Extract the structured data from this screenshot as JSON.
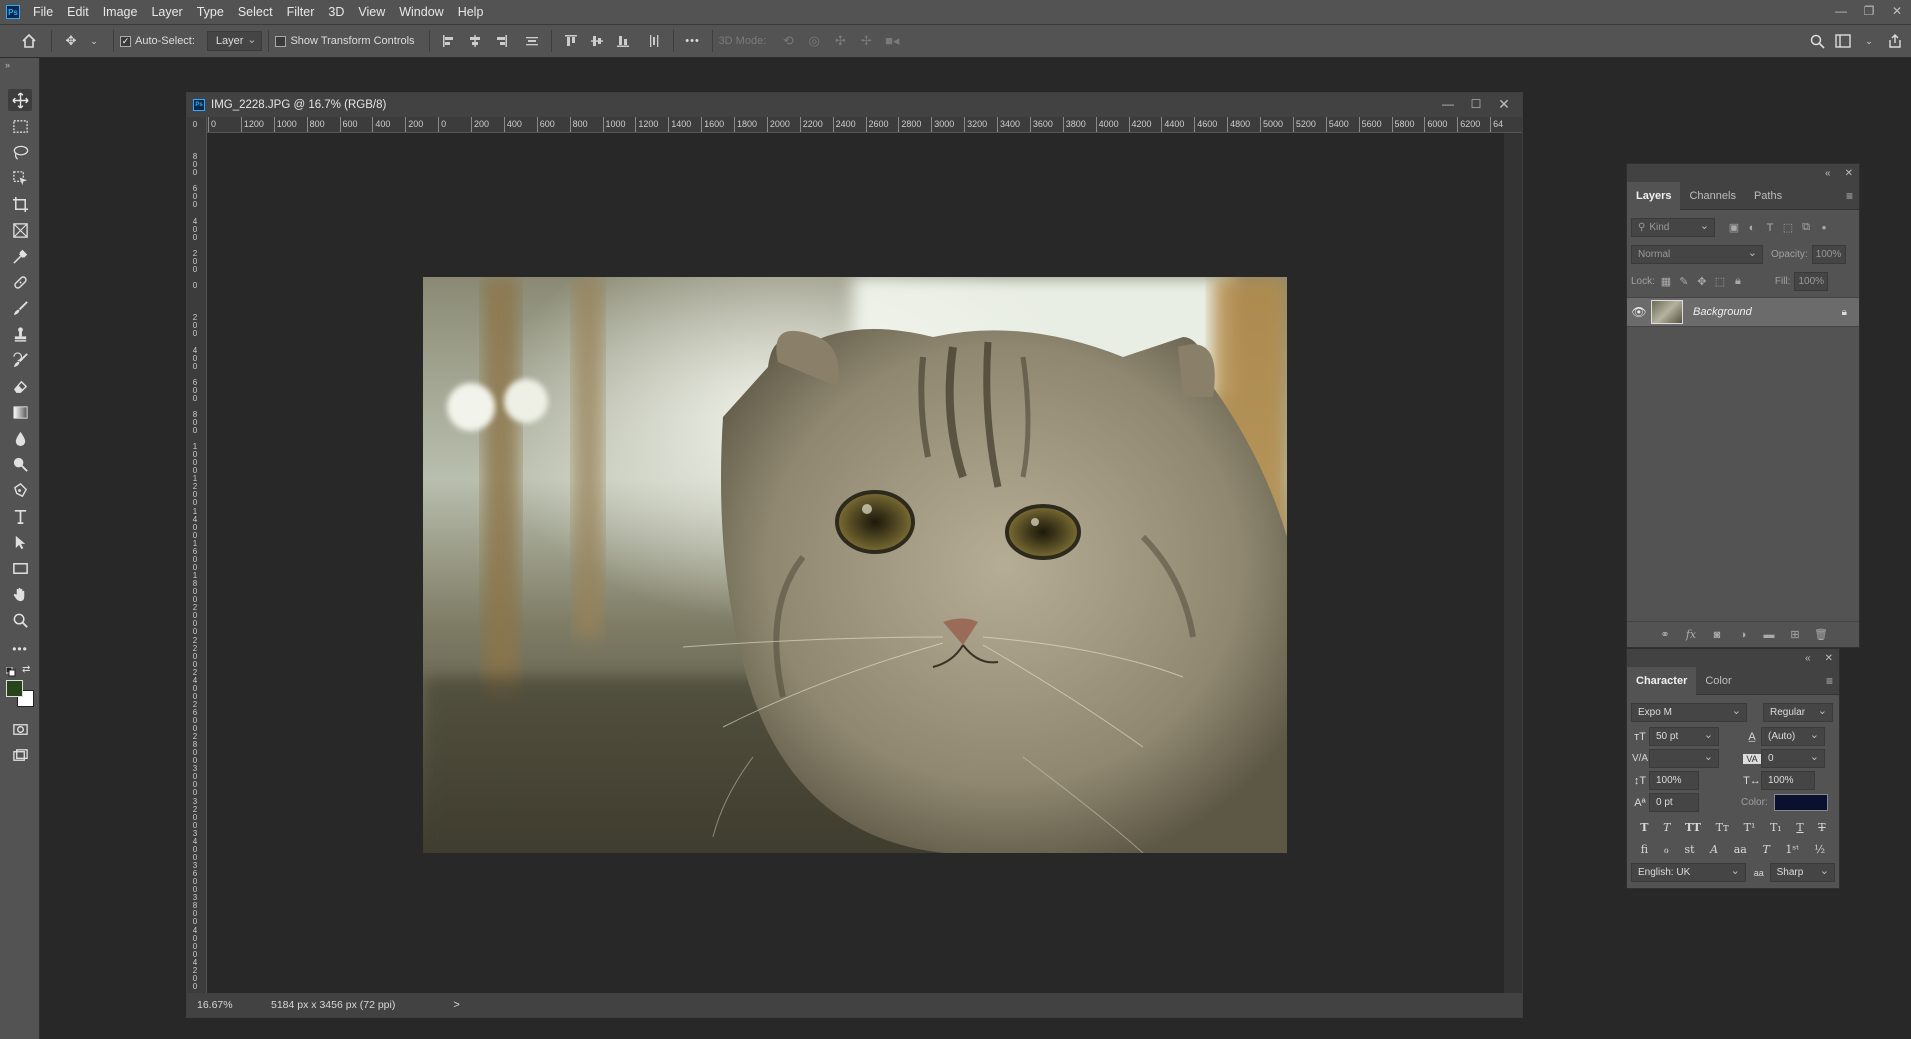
{
  "app": {
    "logo_text": "Ps",
    "menu": [
      "File",
      "Edit",
      "Image",
      "Layer",
      "Type",
      "Select",
      "Filter",
      "3D",
      "View",
      "Window",
      "Help"
    ],
    "window_controls": [
      "minimize",
      "restore",
      "close"
    ]
  },
  "options_bar": {
    "auto_select_label": "Auto-Select:",
    "auto_select_checked": true,
    "auto_select_target": "Layer",
    "show_transform_label": "Show Transform Controls",
    "show_transform_checked": false,
    "three_d_mode_label": "3D Mode:",
    "more_label": "•••"
  },
  "document": {
    "title": "IMG_2228.JPG @ 16.7% (RGB/8)",
    "zoom": "16.67%",
    "dimensions": "5184 px x 3456 px (72 ppi)",
    "status_arrow": ">",
    "h_ruler_labels": [
      "0",
      "1200",
      "1000",
      "800",
      "600",
      "400",
      "200",
      "0",
      "200",
      "400",
      "600",
      "800",
      "1000",
      "1200",
      "1400",
      "1600",
      "1800",
      "2000",
      "2200",
      "2400",
      "2600",
      "2800",
      "3000",
      "3200",
      "3400",
      "3600",
      "3800",
      "4000",
      "4200",
      "4400",
      "4600",
      "4800",
      "5000",
      "5200",
      "5400",
      "5600",
      "5800",
      "6000",
      "6200",
      "64"
    ],
    "v_ruler_labels": [
      "0",
      "800",
      "600",
      "400",
      "200",
      "0",
      "200",
      "400",
      "600",
      "800",
      "1000",
      "1200",
      "1400",
      "1600",
      "1800",
      "2000",
      "2200",
      "2400",
      "2600",
      "2800",
      "3000",
      "3200",
      "3400",
      "3600",
      "3800",
      "4000",
      "4200"
    ]
  },
  "layers_panel": {
    "tabs": [
      "Layers",
      "Channels",
      "Paths"
    ],
    "active_tab": "Layers",
    "filter_placeholder": "Kind",
    "blend_mode": "Normal",
    "opacity_label": "Opacity:",
    "opacity_value": "100%",
    "lock_label": "Lock:",
    "fill_label": "Fill:",
    "fill_value": "100%",
    "layers": [
      {
        "name": "Background",
        "visible": true,
        "locked": true
      }
    ]
  },
  "character_panel": {
    "tabs": [
      "Character",
      "Color"
    ],
    "active_tab": "Character",
    "font_family": "Expo M",
    "font_style": "Regular",
    "font_size": "50 pt",
    "leading": "(Auto)",
    "kerning": "",
    "tracking": "0",
    "vertical_scale": "100%",
    "horizontal_scale": "100%",
    "baseline_shift": "0 pt",
    "color_label": "Color:",
    "color_value": "#0a1130",
    "language": "English: UK",
    "antialias_icon": "aa",
    "antialias": "Sharp"
  }
}
